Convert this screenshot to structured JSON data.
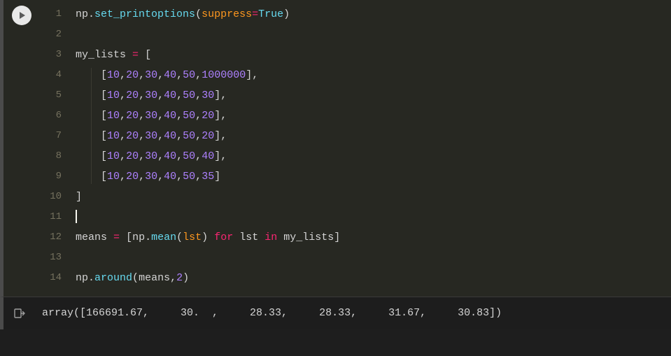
{
  "code": {
    "lines": [
      {
        "n": "1",
        "tokens": [
          {
            "t": "np",
            "c": "ident"
          },
          {
            "t": ".",
            "c": "punct"
          },
          {
            "t": "set_printoptions",
            "c": "func"
          },
          {
            "t": "(",
            "c": "punct"
          },
          {
            "t": "suppress",
            "c": "param"
          },
          {
            "t": "=",
            "c": "op"
          },
          {
            "t": "True",
            "c": "bool"
          },
          {
            "t": ")",
            "c": "punct"
          }
        ]
      },
      {
        "n": "2",
        "tokens": []
      },
      {
        "n": "3",
        "tokens": [
          {
            "t": "my_lists",
            "c": "ident"
          },
          {
            "t": " ",
            "c": "default"
          },
          {
            "t": "=",
            "c": "op"
          },
          {
            "t": " ",
            "c": "default"
          },
          {
            "t": "[",
            "c": "punct"
          }
        ]
      },
      {
        "n": "4",
        "indent": 1,
        "tokens": [
          {
            "t": "    ",
            "c": "default"
          },
          {
            "t": "[",
            "c": "punct"
          },
          {
            "t": "10",
            "c": "num"
          },
          {
            "t": ",",
            "c": "punct"
          },
          {
            "t": "20",
            "c": "num"
          },
          {
            "t": ",",
            "c": "punct"
          },
          {
            "t": "30",
            "c": "num"
          },
          {
            "t": ",",
            "c": "punct"
          },
          {
            "t": "40",
            "c": "num"
          },
          {
            "t": ",",
            "c": "punct"
          },
          {
            "t": "50",
            "c": "num"
          },
          {
            "t": ",",
            "c": "punct"
          },
          {
            "t": "1000000",
            "c": "num"
          },
          {
            "t": "],",
            "c": "punct"
          }
        ]
      },
      {
        "n": "5",
        "indent": 1,
        "tokens": [
          {
            "t": "    ",
            "c": "default"
          },
          {
            "t": "[",
            "c": "punct"
          },
          {
            "t": "10",
            "c": "num"
          },
          {
            "t": ",",
            "c": "punct"
          },
          {
            "t": "20",
            "c": "num"
          },
          {
            "t": ",",
            "c": "punct"
          },
          {
            "t": "30",
            "c": "num"
          },
          {
            "t": ",",
            "c": "punct"
          },
          {
            "t": "40",
            "c": "num"
          },
          {
            "t": ",",
            "c": "punct"
          },
          {
            "t": "50",
            "c": "num"
          },
          {
            "t": ",",
            "c": "punct"
          },
          {
            "t": "30",
            "c": "num"
          },
          {
            "t": "],",
            "c": "punct"
          }
        ]
      },
      {
        "n": "6",
        "indent": 1,
        "tokens": [
          {
            "t": "    ",
            "c": "default"
          },
          {
            "t": "[",
            "c": "punct"
          },
          {
            "t": "10",
            "c": "num"
          },
          {
            "t": ",",
            "c": "punct"
          },
          {
            "t": "20",
            "c": "num"
          },
          {
            "t": ",",
            "c": "punct"
          },
          {
            "t": "30",
            "c": "num"
          },
          {
            "t": ",",
            "c": "punct"
          },
          {
            "t": "40",
            "c": "num"
          },
          {
            "t": ",",
            "c": "punct"
          },
          {
            "t": "50",
            "c": "num"
          },
          {
            "t": ",",
            "c": "punct"
          },
          {
            "t": "20",
            "c": "num"
          },
          {
            "t": "],",
            "c": "punct"
          }
        ]
      },
      {
        "n": "7",
        "indent": 1,
        "tokens": [
          {
            "t": "    ",
            "c": "default"
          },
          {
            "t": "[",
            "c": "punct"
          },
          {
            "t": "10",
            "c": "num"
          },
          {
            "t": ",",
            "c": "punct"
          },
          {
            "t": "20",
            "c": "num"
          },
          {
            "t": ",",
            "c": "punct"
          },
          {
            "t": "30",
            "c": "num"
          },
          {
            "t": ",",
            "c": "punct"
          },
          {
            "t": "40",
            "c": "num"
          },
          {
            "t": ",",
            "c": "punct"
          },
          {
            "t": "50",
            "c": "num"
          },
          {
            "t": ",",
            "c": "punct"
          },
          {
            "t": "20",
            "c": "num"
          },
          {
            "t": "],",
            "c": "punct"
          }
        ]
      },
      {
        "n": "8",
        "indent": 1,
        "tokens": [
          {
            "t": "    ",
            "c": "default"
          },
          {
            "t": "[",
            "c": "punct"
          },
          {
            "t": "10",
            "c": "num"
          },
          {
            "t": ",",
            "c": "punct"
          },
          {
            "t": "20",
            "c": "num"
          },
          {
            "t": ",",
            "c": "punct"
          },
          {
            "t": "30",
            "c": "num"
          },
          {
            "t": ",",
            "c": "punct"
          },
          {
            "t": "40",
            "c": "num"
          },
          {
            "t": ",",
            "c": "punct"
          },
          {
            "t": "50",
            "c": "num"
          },
          {
            "t": ",",
            "c": "punct"
          },
          {
            "t": "40",
            "c": "num"
          },
          {
            "t": "],",
            "c": "punct"
          }
        ]
      },
      {
        "n": "9",
        "indent": 1,
        "tokens": [
          {
            "t": "    ",
            "c": "default"
          },
          {
            "t": "[",
            "c": "punct"
          },
          {
            "t": "10",
            "c": "num"
          },
          {
            "t": ",",
            "c": "punct"
          },
          {
            "t": "20",
            "c": "num"
          },
          {
            "t": ",",
            "c": "punct"
          },
          {
            "t": "30",
            "c": "num"
          },
          {
            "t": ",",
            "c": "punct"
          },
          {
            "t": "40",
            "c": "num"
          },
          {
            "t": ",",
            "c": "punct"
          },
          {
            "t": "50",
            "c": "num"
          },
          {
            "t": ",",
            "c": "punct"
          },
          {
            "t": "35",
            "c": "num"
          },
          {
            "t": "]",
            "c": "punct"
          }
        ]
      },
      {
        "n": "10",
        "tokens": [
          {
            "t": "]",
            "c": "punct"
          }
        ]
      },
      {
        "n": "11",
        "cursor": true,
        "tokens": []
      },
      {
        "n": "12",
        "tokens": [
          {
            "t": "means",
            "c": "ident"
          },
          {
            "t": " ",
            "c": "default"
          },
          {
            "t": "=",
            "c": "op"
          },
          {
            "t": " ",
            "c": "default"
          },
          {
            "t": "[",
            "c": "punct"
          },
          {
            "t": "np",
            "c": "ident"
          },
          {
            "t": ".",
            "c": "punct"
          },
          {
            "t": "mean",
            "c": "func"
          },
          {
            "t": "(",
            "c": "punct"
          },
          {
            "t": "lst",
            "c": "param"
          },
          {
            "t": ")",
            "c": "punct"
          },
          {
            "t": " ",
            "c": "default"
          },
          {
            "t": "for",
            "c": "kw"
          },
          {
            "t": " ",
            "c": "default"
          },
          {
            "t": "lst",
            "c": "ident"
          },
          {
            "t": " ",
            "c": "default"
          },
          {
            "t": "in",
            "c": "kw"
          },
          {
            "t": " ",
            "c": "default"
          },
          {
            "t": "my_lists",
            "c": "ident"
          },
          {
            "t": "]",
            "c": "punct"
          }
        ]
      },
      {
        "n": "13",
        "tokens": []
      },
      {
        "n": "14",
        "tokens": [
          {
            "t": "np",
            "c": "ident"
          },
          {
            "t": ".",
            "c": "punct"
          },
          {
            "t": "around",
            "c": "func"
          },
          {
            "t": "(",
            "c": "punct"
          },
          {
            "t": "means",
            "c": "ident"
          },
          {
            "t": ",",
            "c": "punct"
          },
          {
            "t": "2",
            "c": "num"
          },
          {
            "t": ")",
            "c": "punct"
          }
        ]
      }
    ]
  },
  "output": {
    "text": "array([166691.67,     30.  ,     28.33,     28.33,     31.67,     30.83])"
  }
}
